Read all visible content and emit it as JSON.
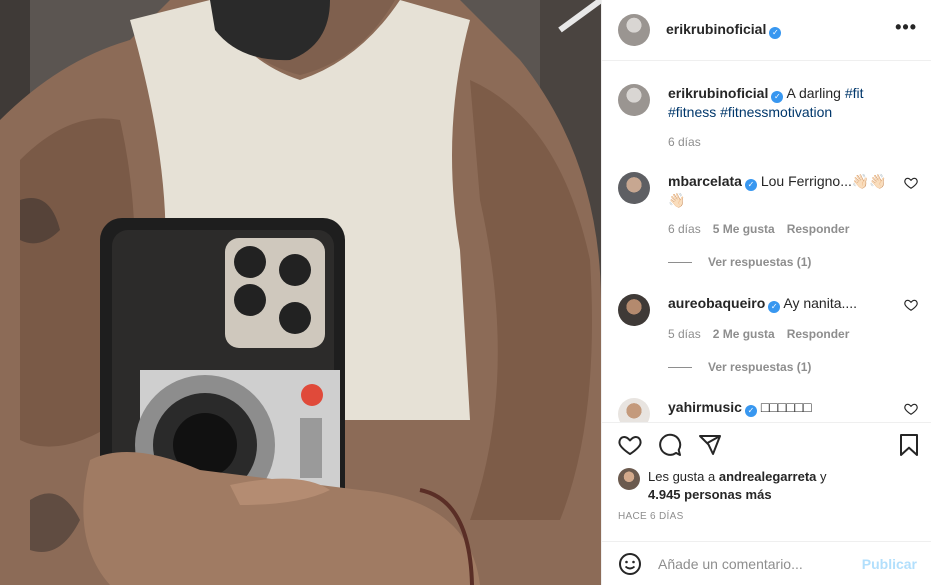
{
  "post": {
    "username": "erikrubinoficial",
    "caption_text": "A darling",
    "tags": [
      "#fit",
      "#fitness",
      "#fitnessmotivation"
    ],
    "caption_time": "6 días"
  },
  "comments": [
    {
      "username": "mbarcelata",
      "text": "Lou Ferrigno...",
      "emoji": "👋🏻👋🏻👋🏻",
      "time": "6 días",
      "likes": "5 Me gusta",
      "reply": "Responder",
      "view_replies": "Ver respuestas (1)"
    },
    {
      "username": "aureobaqueiro",
      "text": "Ay nanita....",
      "time": "5 días",
      "likes": "2 Me gusta",
      "reply": "Responder",
      "view_replies": "Ver respuestas (1)"
    },
    {
      "username": "yahirmusic",
      "text": "□□□□□□"
    }
  ],
  "likes": {
    "prefix": "Les gusta a",
    "user": "andrealegarreta",
    "connector": "y",
    "count": "4.945 personas más"
  },
  "timestamp": "HACE 6 DÍAS",
  "composer": {
    "placeholder": "Añade un comentario...",
    "post_label": "Publicar"
  },
  "icons": {
    "more": "more-options-icon",
    "verified": "verified-badge-icon",
    "like": "heart-icon",
    "comment": "comment-icon",
    "share": "share-icon",
    "save": "bookmark-icon",
    "emoji": "emoji-icon"
  },
  "colors": {
    "verified": "#3897f0",
    "hashtag": "#00376b",
    "muted": "#8e8e8e",
    "post_disabled": "#b2dffc"
  }
}
